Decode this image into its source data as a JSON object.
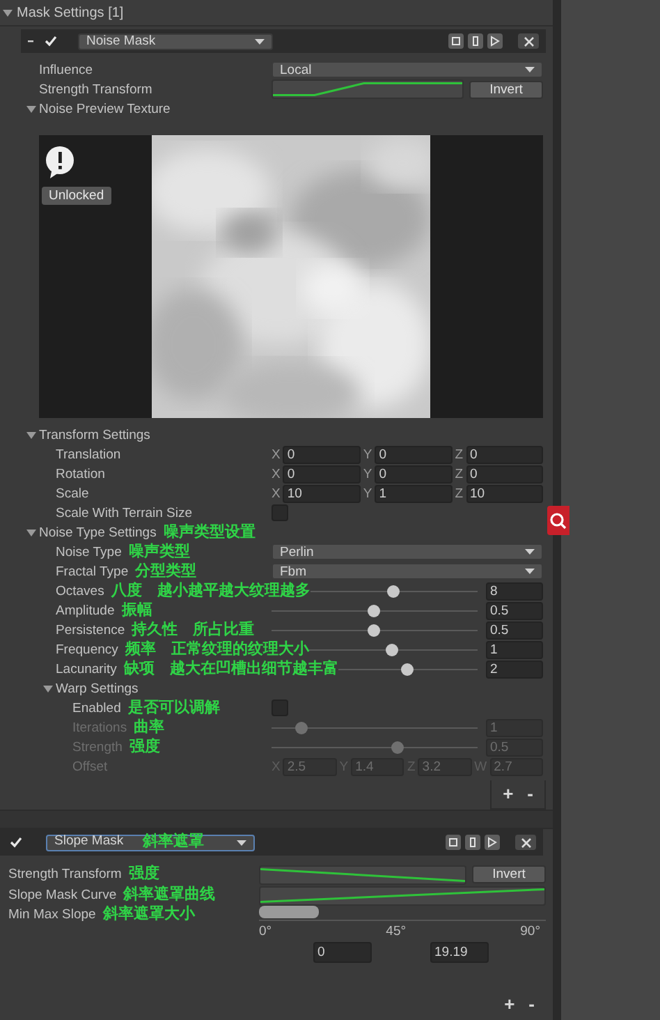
{
  "section": {
    "title": "Mask Settings [1]",
    "expanded": true
  },
  "masks": [
    {
      "enabled": true,
      "type": "Noise Mask",
      "focused": false,
      "rows": [
        {
          "kind": "dropdown",
          "label": "Influence",
          "value": "Local"
        },
        {
          "kind": "curve",
          "label": "Strength Transform",
          "curve": {
            "kind": "rise"
          },
          "button": "Invert"
        },
        {
          "kind": "foldout",
          "label": "Noise Preview Texture",
          "expanded": true,
          "children": [
            {
              "kind": "preview",
              "button": "Unlocked"
            }
          ]
        },
        {
          "kind": "foldout",
          "label": "Transform Settings",
          "expanded": true,
          "children": [
            {
              "kind": "vector",
              "label": "Translation",
              "fields": [
                {
                  "axis": "X",
                  "value": "0"
                },
                {
                  "axis": "Y",
                  "value": "0"
                },
                {
                  "axis": "Z",
                  "value": "0"
                }
              ]
            },
            {
              "kind": "vector",
              "label": "Rotation",
              "fields": [
                {
                  "axis": "X",
                  "value": "0"
                },
                {
                  "axis": "Y",
                  "value": "0"
                },
                {
                  "axis": "Z",
                  "value": "0"
                }
              ]
            },
            {
              "kind": "vector",
              "label": "Scale",
              "fields": [
                {
                  "axis": "X",
                  "value": "10"
                },
                {
                  "axis": "Y",
                  "value": "1"
                },
                {
                  "axis": "Z",
                  "value": "10"
                }
              ]
            },
            {
              "kind": "checkbox",
              "label": "Scale With Terrain Size",
              "checked": false
            }
          ]
        },
        {
          "kind": "foldout",
          "label": "Noise Type Settings",
          "notes": [
            "噪声类型设置"
          ],
          "expanded": true,
          "children": [
            {
              "kind": "dropdown",
              "label": "Noise Type",
              "notes": [
                "噪声类型"
              ],
              "value": "Perlin"
            },
            {
              "kind": "dropdown",
              "label": "Fractal Type",
              "notes": [
                "分型类型"
              ],
              "value": "Fbm"
            },
            {
              "kind": "slider",
              "label": "Octaves",
              "notes": [
                "八度",
                "越小越平越大纹理越多"
              ],
              "level": 0.49,
              "value": "8"
            },
            {
              "kind": "slider",
              "label": "Amplitude",
              "notes": [
                "振幅"
              ],
              "level": 0.49,
              "value": "0.5"
            },
            {
              "kind": "slider",
              "label": "Persistence",
              "notes": [
                "持久性",
                "所占比重"
              ],
              "level": 0.49,
              "value": "0.5"
            },
            {
              "kind": "slider",
              "label": "Frequency",
              "notes": [
                "频率",
                "正常纹理的纹理大小"
              ],
              "level": 0.49,
              "value": "1"
            },
            {
              "kind": "slider",
              "label": "Lacunarity",
              "notes": [
                "缺项",
                "越大在凹槽出细节越丰富"
              ],
              "level": 0.49,
              "value": "2"
            },
            {
              "kind": "foldout",
              "label": "Warp Settings",
              "expanded": true,
              "children": [
                {
                  "kind": "checkbox",
                  "label": "Enabled",
                  "notes": [
                    "是否可以调解"
                  ],
                  "checked": false,
                  "disabled": false
                },
                {
                  "kind": "slider",
                  "label": "Iterations",
                  "notes": [
                    "曲率"
                  ],
                  "level": 0.14,
                  "value": "1",
                  "disabled": true
                },
                {
                  "kind": "slider",
                  "label": "Strength",
                  "notes": [
                    "强度"
                  ],
                  "level": 0.61,
                  "value": "0.5",
                  "disabled": true
                },
                {
                  "kind": "vector",
                  "label": "Offset",
                  "disabled": true,
                  "fields": [
                    {
                      "axis": "X",
                      "value": "2.5"
                    },
                    {
                      "axis": "Y",
                      "value": "1.4"
                    },
                    {
                      "axis": "Z",
                      "value": "3.2"
                    },
                    {
                      "axis": "W",
                      "value": "2.7"
                    }
                  ]
                }
              ]
            }
          ]
        }
      ],
      "footer": [
        "+",
        "-"
      ]
    },
    {
      "enabled": true,
      "type": "Slope Mask",
      "type_note": "斜率遮罩",
      "focused": true,
      "rows": [
        {
          "kind": "curve",
          "label": "Strength Transform",
          "notes": [
            "强度"
          ],
          "curve": {
            "kind": "fall"
          },
          "button": "Invert"
        },
        {
          "kind": "curve",
          "label": "Slope Mask Curve",
          "notes": [
            "斜率遮罩曲线"
          ],
          "curve": {
            "kind": "ramp_up"
          }
        },
        {
          "kind": "minmax",
          "label": "Min Max Slope",
          "notes": [
            "斜率遮罩大小"
          ],
          "level": 0.21,
          "ticks": [
            "0°",
            "45°",
            "90°"
          ],
          "min": "0",
          "max": "19.19"
        }
      ],
      "footer": [
        "+",
        "-"
      ]
    }
  ]
}
